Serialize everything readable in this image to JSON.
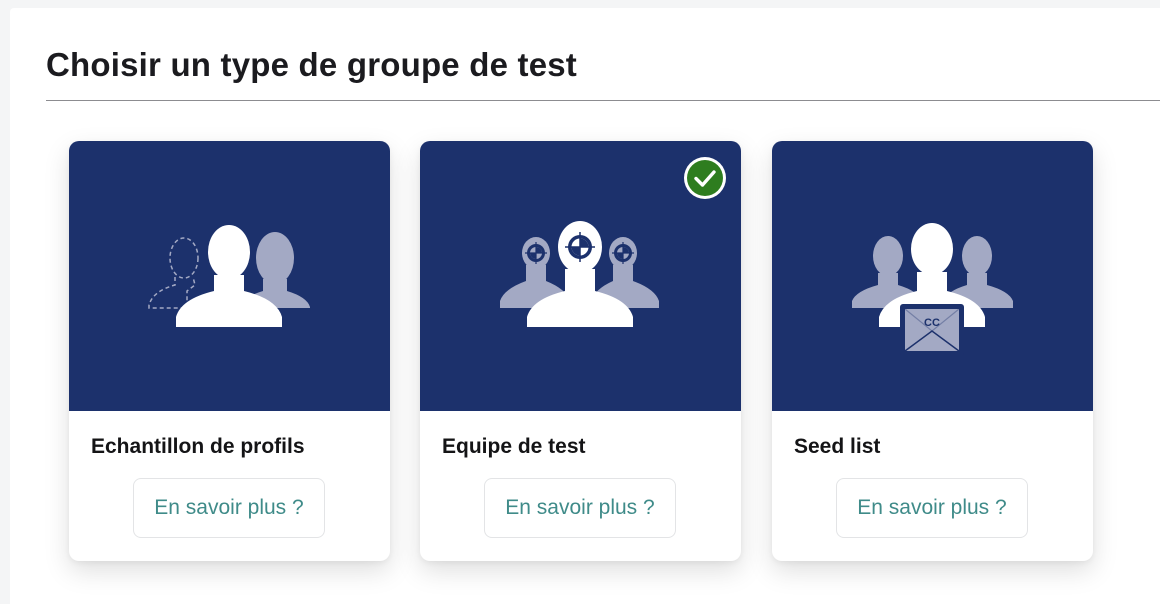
{
  "page": {
    "title": "Choisir un type de groupe de test"
  },
  "cards": [
    {
      "title": "Echantillon de profils",
      "button_label": "En savoir plus ?",
      "icon": "profile-sample-icon",
      "selected": false
    },
    {
      "title": "Equipe de test",
      "button_label": "En savoir plus ?",
      "icon": "test-team-icon",
      "selected": true
    },
    {
      "title": "Seed list",
      "button_label": "En savoir plus ?",
      "icon": "seed-list-icon",
      "envelope_label": "CC",
      "selected": false
    }
  ],
  "colors": {
    "card_media": "#1c316c",
    "accent_text": "#3f8b89",
    "selected_badge": "#2e7d1f",
    "figure_primary": "#ffffff",
    "figure_secondary": "#a3a9c4"
  }
}
